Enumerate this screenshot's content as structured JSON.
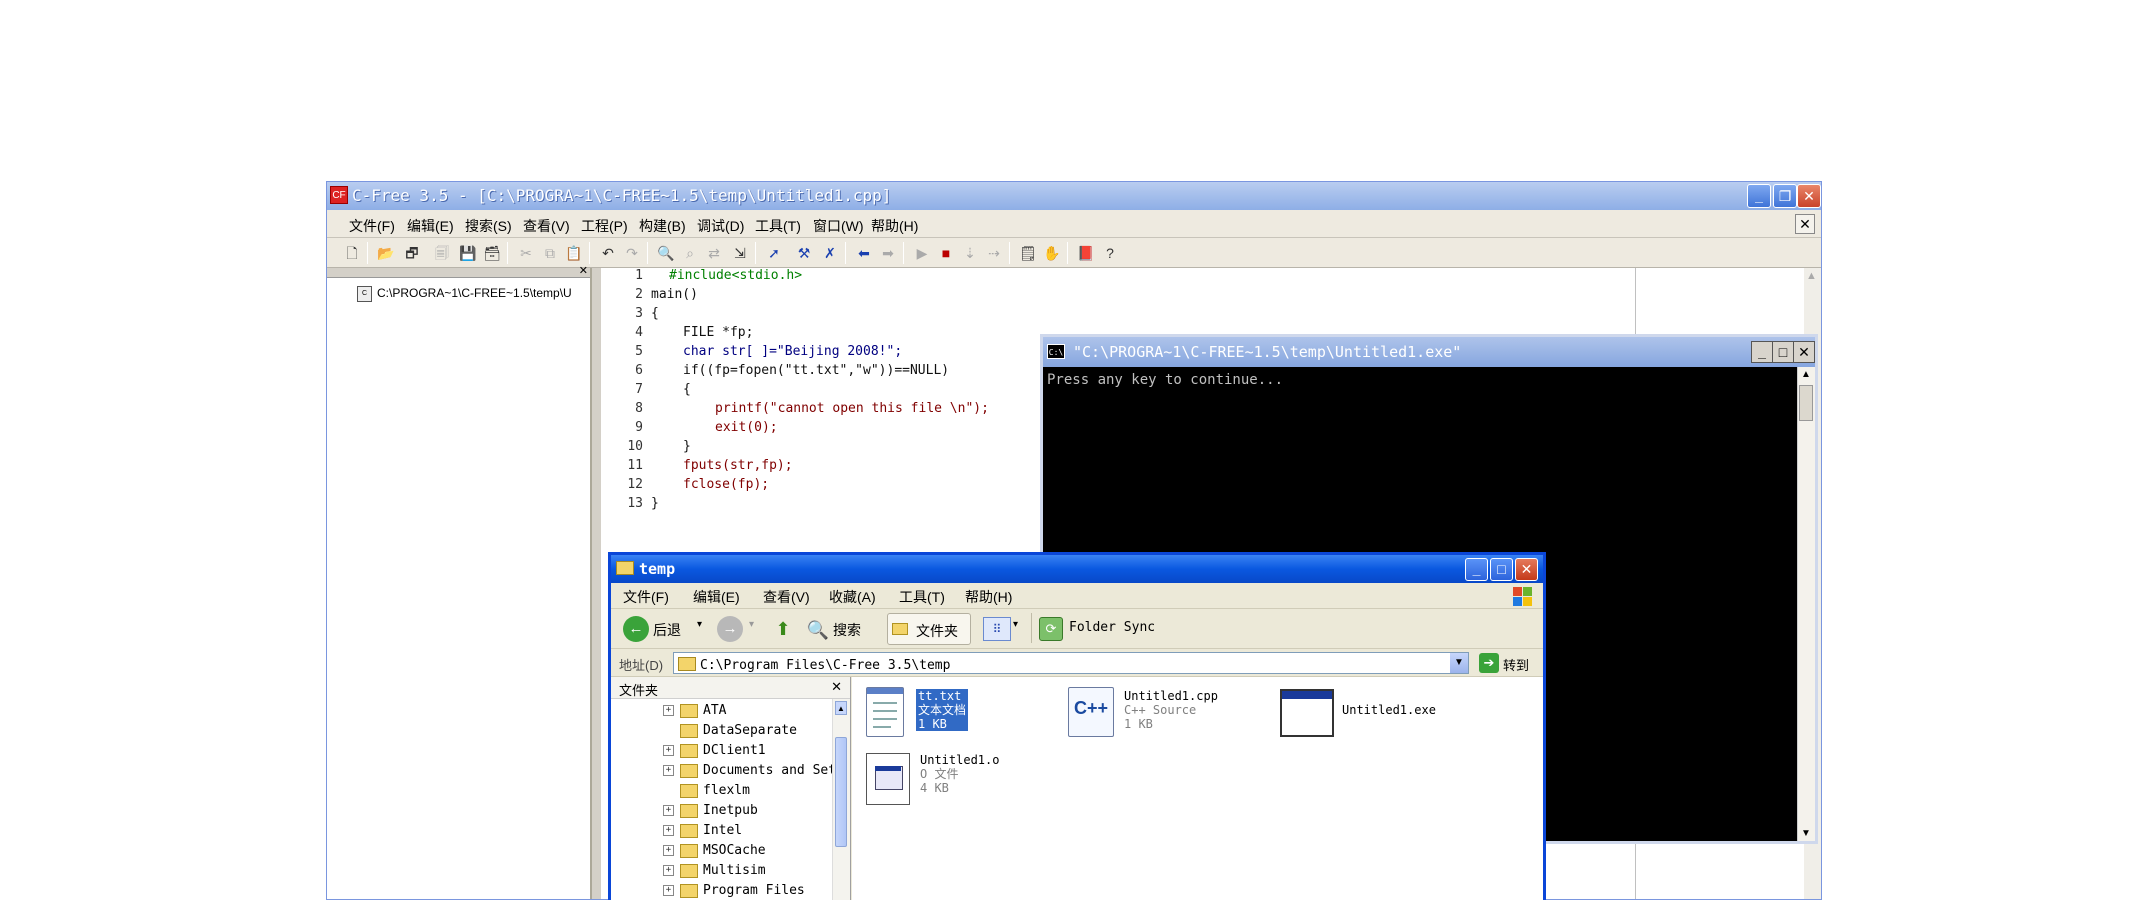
{
  "cfree": {
    "title": "C-Free 3.5 - [C:\\PROGRA~1\\C-FREE~1.5\\temp\\Untitled1.cpp]",
    "menu": [
      "文件(F)",
      "编辑(E)",
      "搜索(S)",
      "查看(V)",
      "工程(P)",
      "构建(B)",
      "调试(D)",
      "工具(T)",
      "窗口(W)",
      "帮助(H)"
    ],
    "left_panel": {
      "file_node": "C:\\PROGRA~1\\C-FREE~1.5\\temp\\U"
    },
    "editor": {
      "line_numbers": [
        "1",
        "2",
        "3",
        "4",
        "5",
        "6",
        "7",
        "8",
        "9",
        "10",
        "11",
        "12",
        "13"
      ],
      "lines": [
        "#include<stdio.h>",
        "main()",
        "{",
        "FILE *fp;",
        "char str[ ]=\"Beijing 2008!\";",
        "if((fp=fopen(\"tt.txt\",\"w\"))==NULL)",
        "{",
        "printf(\"cannot open this file \\n\");",
        "exit(0);",
        "}",
        "fputs(str,fp);",
        "fclose(fp);",
        "}"
      ]
    },
    "colors": {
      "title_bar": "#8eaee6",
      "keyword": "#000080",
      "preprocessor": "#008000"
    }
  },
  "console": {
    "title": "\"C:\\PROGRA~1\\C-FREE~1.5\\temp\\Untitled1.exe\"",
    "output": "Press any key to continue..."
  },
  "explorer": {
    "title": "temp",
    "menu": [
      "文件(F)",
      "编辑(E)",
      "查看(V)",
      "收藏(A)",
      "工具(T)",
      "帮助(H)"
    ],
    "toolbar": {
      "back": "后退",
      "search": "搜索",
      "folders": "文件夹",
      "folder_sync": "Folder Sync"
    },
    "address": {
      "label": "地址(D)",
      "value": "C:\\Program Files\\C-Free 3.5\\temp",
      "go": "转到"
    },
    "folders_panel": {
      "title": "文件夹",
      "items": [
        {
          "name": "ATA",
          "expandable": true
        },
        {
          "name": "DataSeparate",
          "expandable": false
        },
        {
          "name": "DClient1",
          "expandable": true
        },
        {
          "name": "Documents and Set",
          "expandable": true
        },
        {
          "name": "flexlm",
          "expandable": false
        },
        {
          "name": "Inetpub",
          "expandable": true
        },
        {
          "name": "Intel",
          "expandable": true
        },
        {
          "name": "MSOCache",
          "expandable": true
        },
        {
          "name": "Multisim",
          "expandable": true
        },
        {
          "name": "Program Files",
          "expandable": true
        }
      ]
    },
    "files": [
      {
        "name": "tt.txt",
        "type": "文本文档",
        "size": "1 KB",
        "icon": "text-file-icon",
        "selected": true
      },
      {
        "name": "Untitled1.cpp",
        "type": "C++ Source",
        "size": "1 KB",
        "icon": "cpp-file-icon",
        "selected": false
      },
      {
        "name": "Untitled1.exe",
        "type": "",
        "size": "",
        "icon": "exe-file-icon",
        "selected": false
      },
      {
        "name": "Untitled1.o",
        "type": "O 文件",
        "size": "4 KB",
        "icon": "object-file-icon",
        "selected": false
      }
    ],
    "colors": {
      "title_bar": "#0a58e0",
      "selection": "#316ac5"
    }
  }
}
